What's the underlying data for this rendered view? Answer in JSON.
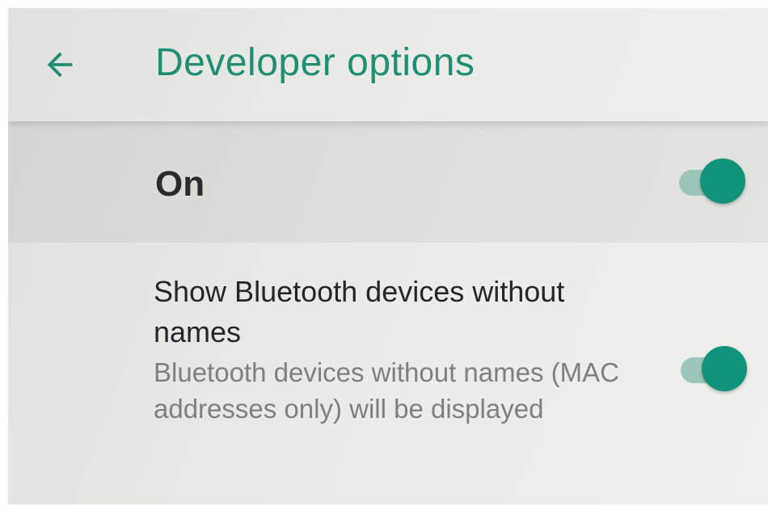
{
  "app_bar": {
    "back_icon": "arrow-left-icon",
    "title": "Developer options",
    "accent_color": "#1f8f73"
  },
  "master_switch": {
    "label": "On",
    "checked": true
  },
  "settings": [
    {
      "title": "Show Bluetooth devices without names",
      "summary": "Bluetooth devices without names (MAC addresses only) will be displayed",
      "checked": true
    }
  ],
  "colors": {
    "switch_thumb_on": "#11927a",
    "switch_track_on": "#8fbeb1"
  }
}
